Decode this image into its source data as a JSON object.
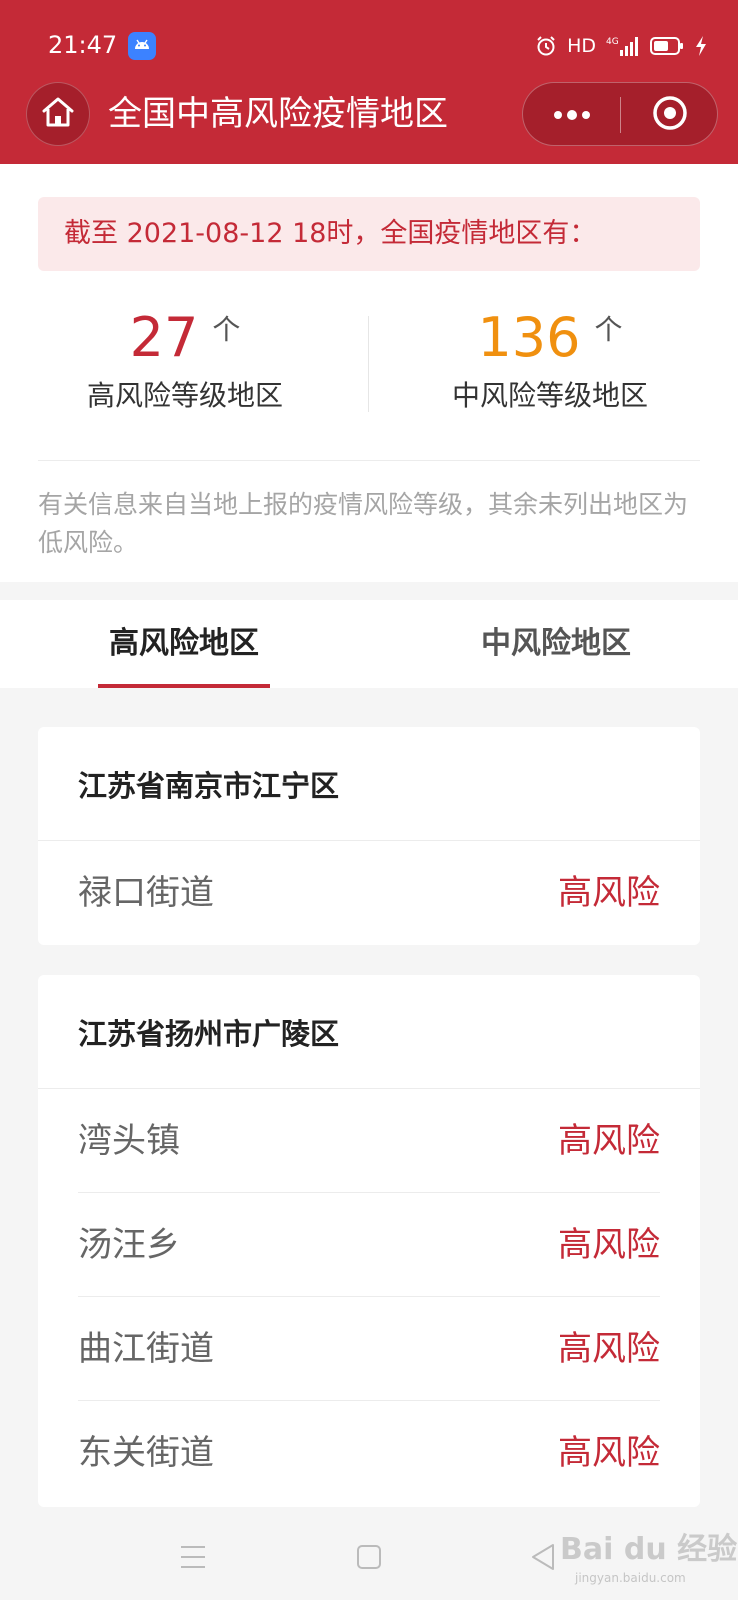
{
  "status_bar": {
    "time": "21:47",
    "hd_label": "HD",
    "network_label": "4G",
    "icons": [
      "android-app-icon",
      "alarm-icon",
      "signal-icon",
      "battery-icon",
      "charging-icon"
    ]
  },
  "nav_bar": {
    "title": "全国中高风险疫情地区",
    "icons": [
      "home-icon",
      "more-icon",
      "close-mini-program-icon"
    ]
  },
  "summary": {
    "notice": "截至 2021-08-12 18时，全国疫情地区有：",
    "high": {
      "count": "27",
      "unit": "个",
      "label": "高风险等级地区"
    },
    "mid": {
      "count": "136",
      "unit": "个",
      "label": "中风险等级地区"
    },
    "note": "有关信息来自当地上报的疫情风险等级，其余未列出地区为低风险。"
  },
  "tabs": [
    {
      "label": "高风险地区",
      "active": true
    },
    {
      "label": "中风险地区",
      "active": false
    }
  ],
  "regions": [
    {
      "name": "江苏省南京市江宁区",
      "areas": [
        {
          "name": "禄口街道",
          "level": "高风险"
        }
      ]
    },
    {
      "name": "江苏省扬州市广陵区",
      "areas": [
        {
          "name": "湾头镇",
          "level": "高风险"
        },
        {
          "name": "汤汪乡",
          "level": "高风险"
        },
        {
          "name": "曲江街道",
          "level": "高风险"
        },
        {
          "name": "东关街道",
          "level": "高风险"
        }
      ]
    }
  ],
  "watermark": {
    "text": "Bai du 经验",
    "sub": "jingyan.baidu.com"
  },
  "system_nav": {
    "icons": [
      "menu-icon",
      "home-square-icon",
      "back-icon"
    ]
  },
  "colors": {
    "brand_red": "#c42a37",
    "mid_orange": "#f0900f",
    "notice_bg": "#fbe9ea"
  }
}
